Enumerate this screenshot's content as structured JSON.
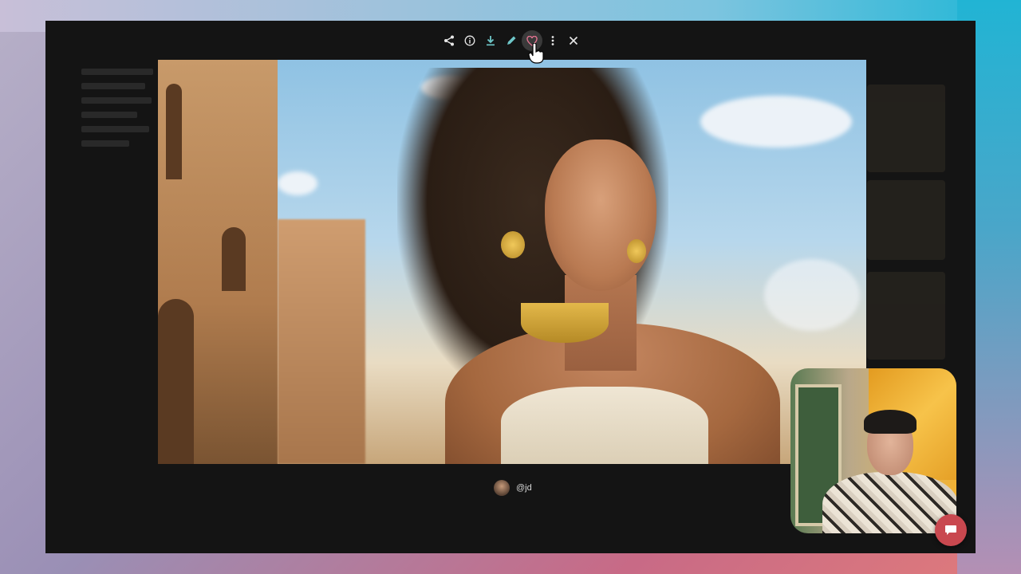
{
  "viewer": {
    "author_handle": "@jd",
    "toolbar": {
      "share_icon": "share-icon",
      "info_icon": "info-icon",
      "download_icon": "download-icon",
      "edit_icon": "edit-icon",
      "heart_icon": "heart-icon",
      "more_icon": "more-vertical-icon",
      "close_icon": "close-icon"
    },
    "colors": {
      "accent_teal": "#6ec7c9",
      "heart_pink": "#e0728f",
      "chat_red": "#c9484f"
    }
  }
}
